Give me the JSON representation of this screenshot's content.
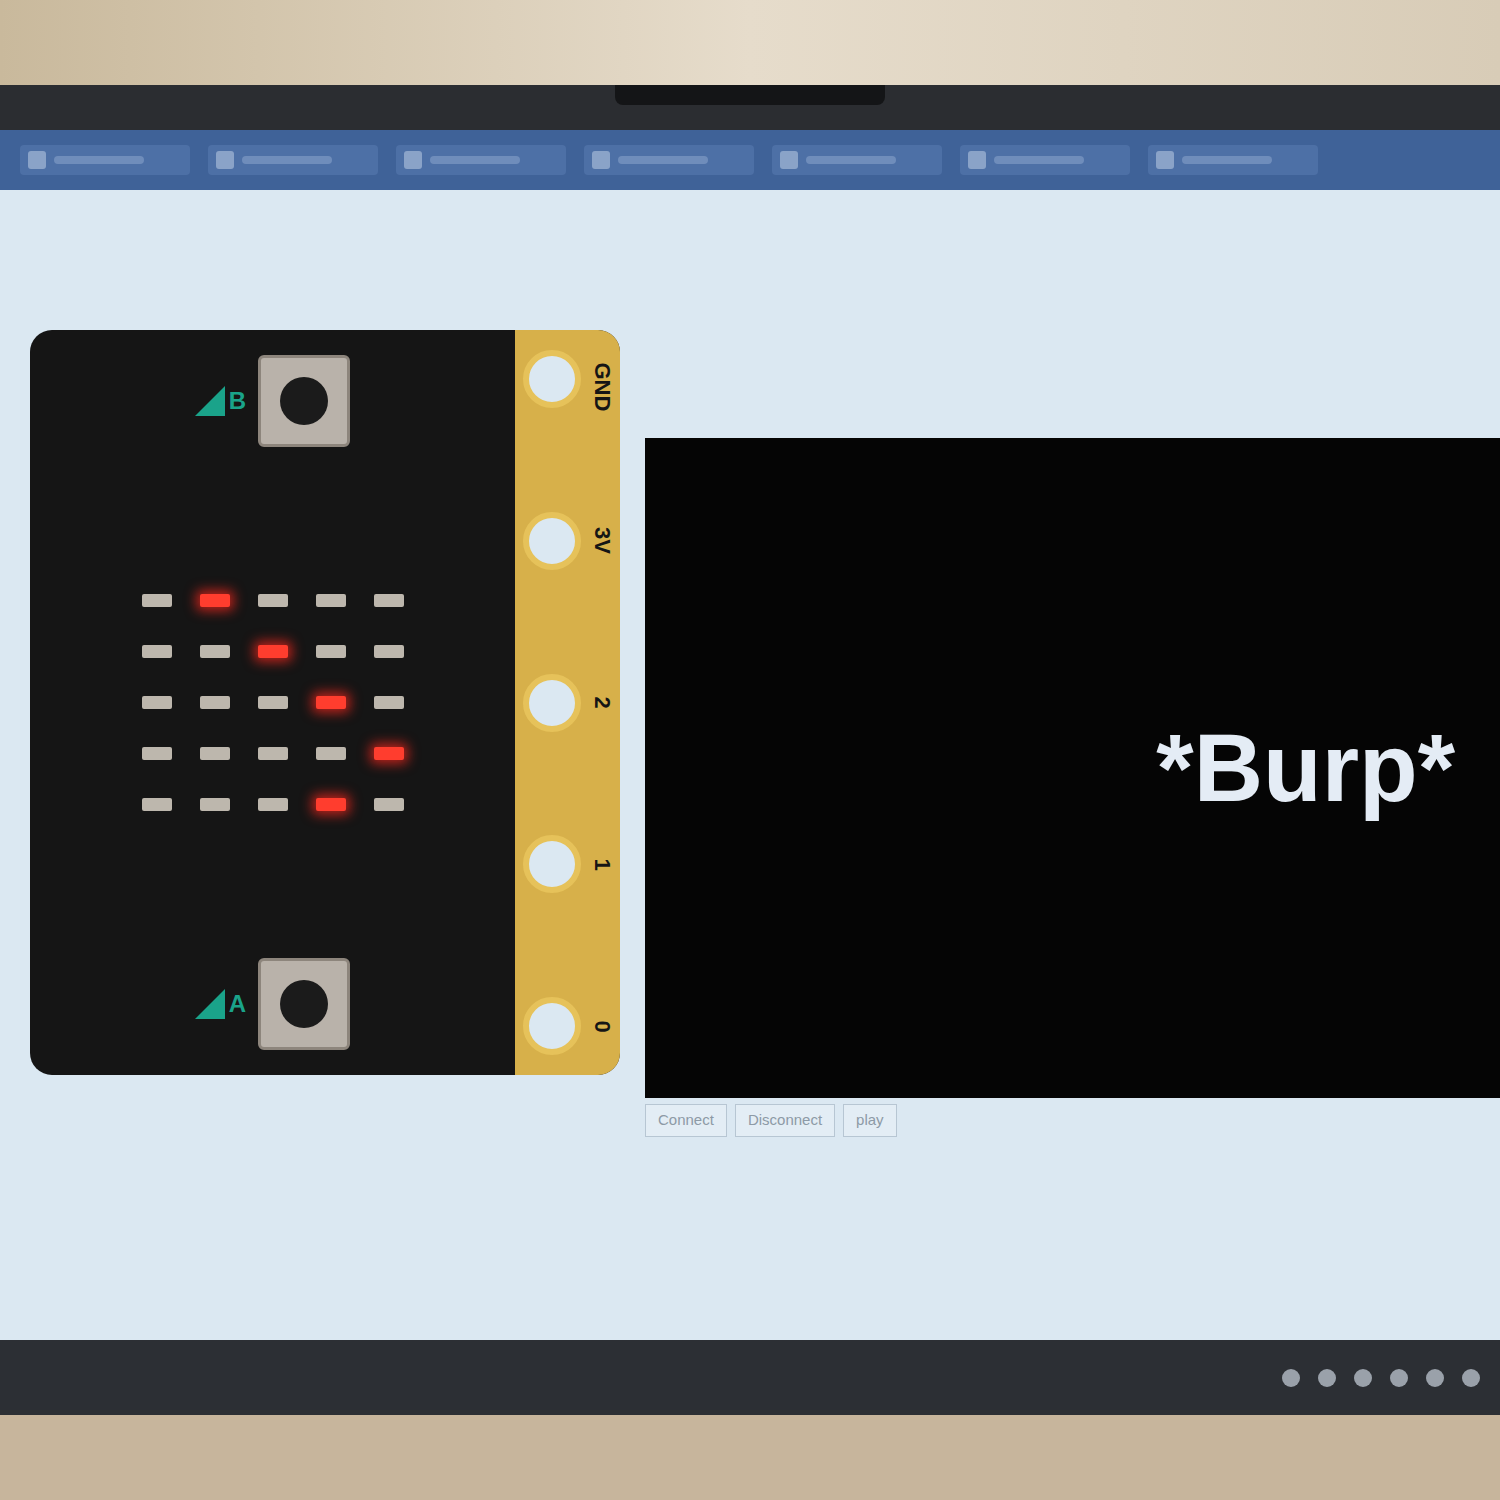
{
  "microbit": {
    "buttons": [
      {
        "label": "B"
      },
      {
        "label": "A"
      }
    ],
    "pins": [
      "GND",
      "3V",
      "2",
      "1",
      "0"
    ],
    "leds": [
      [
        false,
        true,
        false,
        false,
        false
      ],
      [
        false,
        false,
        true,
        false,
        false
      ],
      [
        false,
        false,
        false,
        true,
        false
      ],
      [
        false,
        false,
        false,
        false,
        true
      ],
      [
        false,
        false,
        false,
        true,
        false
      ]
    ]
  },
  "output": {
    "text": "*Burp*"
  },
  "controls": [
    "Connect",
    "Disconnect",
    "play"
  ]
}
